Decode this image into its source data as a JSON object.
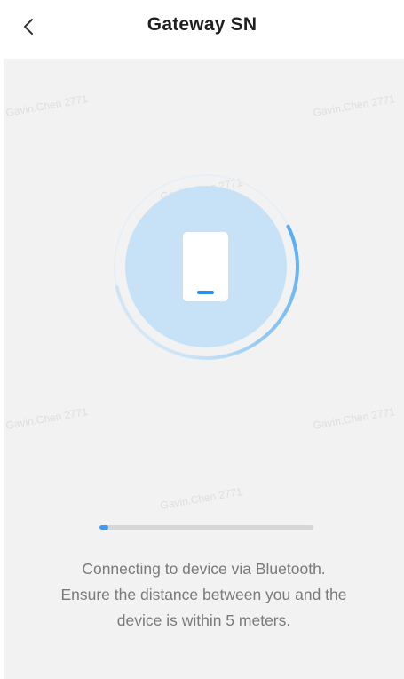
{
  "header": {
    "title": "Gateway SN",
    "back_icon": "chevron-left-icon"
  },
  "illustration": {
    "icon": "phone-bluetooth-icon",
    "colors": {
      "ring": "#4aa7f5",
      "disc": "#c7e2f7",
      "phone": "#ffffff",
      "indicator": "#2f8fe8"
    }
  },
  "progress": {
    "value_percent": 4,
    "color": "#3d9bf3",
    "track_color": "#d6d7d9"
  },
  "message": {
    "line1": "Connecting to device via Bluetooth.",
    "line2": "Ensure the distance between you and the",
    "line3": "device is within 5 meters."
  },
  "watermark": "Gavin.Chen 2771"
}
